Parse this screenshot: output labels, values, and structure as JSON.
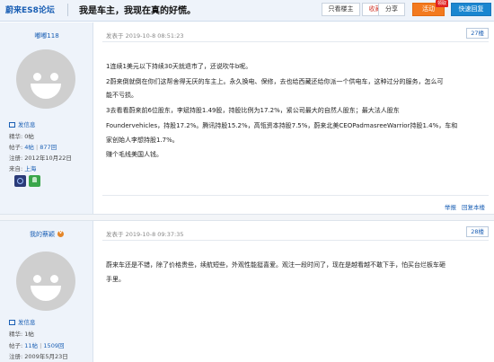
{
  "header": {
    "forum_name": "蔚来ES8论坛",
    "thread_title": "我是车主，我现在真的好慌。",
    "owner_only": "只看楼主",
    "favorite": "收藏",
    "share": "分享",
    "activity": "活动",
    "activity_tag": "领取",
    "quick_reply": "快速回复"
  },
  "posts": [
    {
      "username": "嘟嘟118",
      "time": "发表于 2019-10-8 08:51:23",
      "floor": "27楼",
      "message_label": "发信息",
      "stats": {
        "essence_label": "精华:",
        "essence": "0帖",
        "posts_label": "帖子:",
        "posts": "4帖",
        "posts_extra": "877回",
        "reg_label": "注册:",
        "reg": "2012年10月22日",
        "from_label": "来自:",
        "from": "上海"
      },
      "lines": [
        "1连续1美元以下持续30天就退市了，还说吹牛b呢。",
        "2蔚来倒就倒在你们这帮舍得无厌的车主上。永久换电、保修，去也给西藏还给你派一个供电车，这种过分的服务，怎么可",
        "能不亏损。",
        "3去看看蔚来前6位股东，李斌持股1.49股，持股比例为17.2%，紧公司最大的自然人股东；最大法人股东",
        "Foundervehicles，持股17.2%。腾讯持股15.2%，高瓴资本持股7.5%，蔚来北美CEOPadmasreeWarrior持股1.4%，车和",
        "家创始人李想持股1.7%。",
        "赚个毛线美国人钱。"
      ],
      "actions": {
        "report": "举报",
        "reply": "回复本楼"
      }
    },
    {
      "username": "我的蔡颖",
      "time": "发表于 2019-10-8 09:37:35",
      "floor": "28楼",
      "message_label": "发信息",
      "stats": {
        "essence_label": "精华:",
        "essence": "1帖",
        "posts_label": "帖子:",
        "posts": "11帖",
        "posts_extra": "1509回",
        "reg_label": "注册:",
        "reg": "2009年5月23日"
      },
      "lines": [
        "蔚来车还是不错，除了价格贵些，续航短些，外观性能挺喜爱。观注一段时间了，现在是越看越不敢下手，怕买台烂板车砸",
        "手里。"
      ]
    }
  ]
}
